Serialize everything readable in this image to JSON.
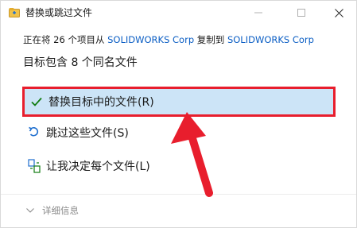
{
  "window": {
    "title": "替换或跳过文件",
    "minimize_icon": "minimize-icon",
    "maximize_icon": "maximize-icon",
    "close_icon": "close-icon"
  },
  "subtitle": {
    "prefix": "正在将 26 个项目从 ",
    "source": "SOLIDWORKS Corp",
    "middle": " 复制到 ",
    "destination": "SOLIDWORKS Corp"
  },
  "heading": "目标包含 8 个同名文件",
  "options": [
    {
      "label": "替换目标中的文件(R)",
      "icon": "checkmark-icon"
    },
    {
      "label": "跳过这些文件(S)",
      "icon": "skip-arrow-icon"
    },
    {
      "label": "让我决定每个文件(L)",
      "icon": "decide-icon"
    }
  ],
  "details": {
    "label": "详细信息",
    "icon": "chevron-down-icon"
  },
  "colors": {
    "accent": "#0b5ec4",
    "highlight_bg": "#cce4f7",
    "annotation_red": "#e81e2d",
    "check_green": "#107c10"
  }
}
